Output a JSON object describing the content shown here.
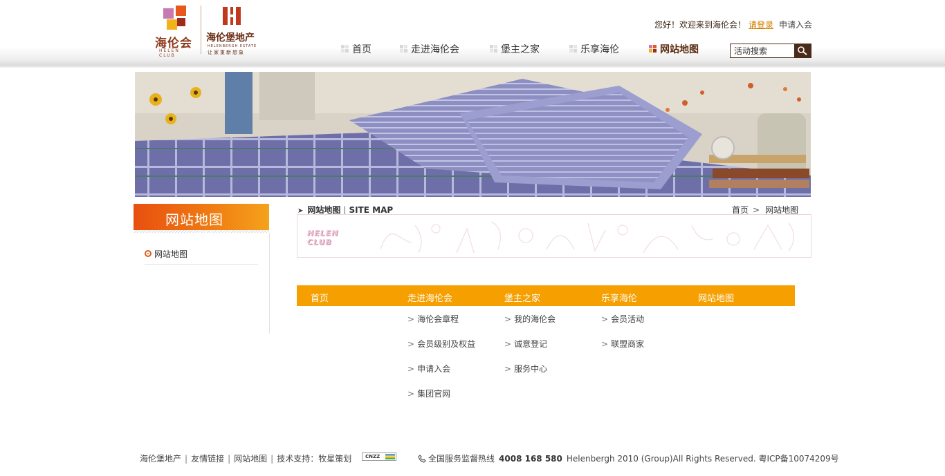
{
  "header": {
    "logo_helen_text": "海伦会",
    "logo_helen_sub": "HELEN CLUB",
    "logo_estate_text": "海伦堡地产",
    "logo_estate_sub1": "HELENBERGH ESTATE",
    "logo_estate_sub2": "让家重新想象",
    "welcome_text": "您好！欢迎来到海伦会！",
    "login_label": "请登录",
    "apply_label": "申请入会",
    "nav": [
      {
        "label": "首页",
        "active": false
      },
      {
        "label": "走进海伦会",
        "active": false
      },
      {
        "label": "堡主之家",
        "active": false
      },
      {
        "label": "乐享海伦",
        "active": false
      },
      {
        "label": "网站地图",
        "active": true
      }
    ],
    "search_value": "活动搜索",
    "search_icon": "search-icon"
  },
  "sidebar": {
    "title": "网站地图",
    "items": [
      {
        "label": "网站地图"
      }
    ]
  },
  "main": {
    "heading": "网站地图",
    "heading_sep": "|",
    "heading_en": "SITE MAP",
    "breadcrumb": {
      "home": "首页",
      "separator": ">",
      "current": "网站地图"
    },
    "deco_text_1": "HELEN",
    "deco_text_2": "CLUB",
    "sitemap": {
      "columns": [
        {
          "title": "首页",
          "links": []
        },
        {
          "title": "走进海伦会",
          "links": [
            "海伦会章程",
            "会员级别及权益",
            "申请入会",
            "集团官网"
          ]
        },
        {
          "title": "堡主之家",
          "links": [
            "我的海伦会",
            "诚意登记",
            "服务中心"
          ]
        },
        {
          "title": "乐享海伦",
          "links": [
            "会员活动",
            "联盟商家"
          ]
        },
        {
          "title": "网站地图",
          "links": []
        }
      ]
    }
  },
  "footer": {
    "links": [
      "海伦堡地产",
      "友情链接",
      "网站地图",
      "技术支持：牧星策划"
    ],
    "pipe": "|",
    "cnzz_label": "CNZZ",
    "hotline_label": "全国服务监督热线",
    "hotline_number": "4008 168 580",
    "copyright": "Helenbergh 2010 (Group)All Rights Reserved. 粤ICP备10074209号"
  },
  "colors": {
    "accent_orange": "#f5a000",
    "brand_brown": "#4a2a18",
    "login_link": "#d08000"
  }
}
